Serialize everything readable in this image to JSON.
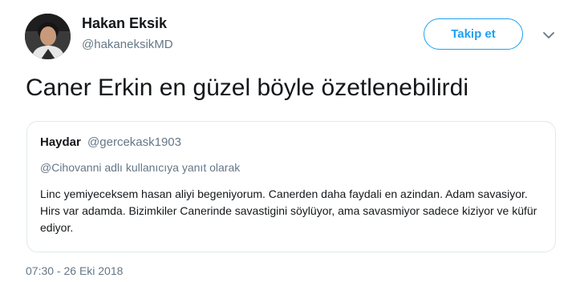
{
  "author": {
    "name": "Hakan Eksik",
    "handle": "@hakaneksikMD",
    "avatar_icon": "user-photo"
  },
  "follow_button": {
    "label": "Takip et"
  },
  "menu_icon": "chevron-down-icon",
  "tweet": {
    "text": "Caner Erkin en güzel böyle özetlenebilirdi",
    "timestamp": "07:30 - 26 Eki 2018"
  },
  "quoted_tweet": {
    "name": "Haydar",
    "handle": "@gercekask1903",
    "reply_context": "@Cihovanni adlı kullanıcıya yanıt olarak",
    "body": "Linc yemiyeceksem hasan aliyi begeniyorum. Canerden daha faydali en azindan. Adam savasiyor. Hirs var adamda. Bizimkiler Canerinde savastigini söylüyor, ama savasmiyor sadece kiziyor ve küfür ediyor."
  },
  "colors": {
    "accent": "#1da1f2",
    "secondary_text": "#657786",
    "border": "#e1e8ed"
  }
}
